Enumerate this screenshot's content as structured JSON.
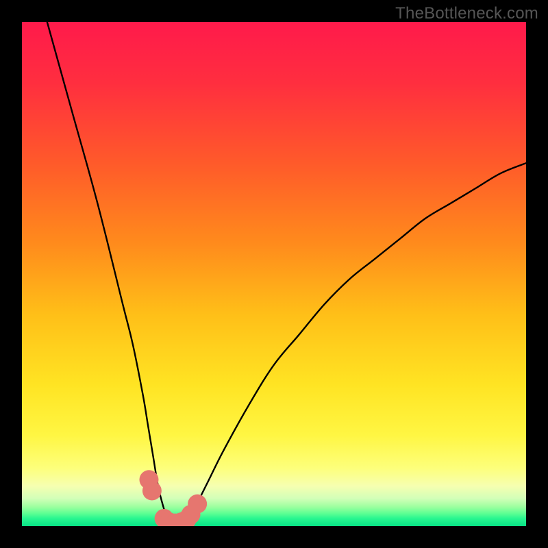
{
  "watermark": "TheBottleneck.com",
  "chart_data": {
    "type": "line",
    "title": "",
    "xlabel": "",
    "ylabel": "",
    "xlim": [
      0,
      100
    ],
    "ylim": [
      0,
      100
    ],
    "series": [
      {
        "name": "bottleneck-curve",
        "x": [
          5,
          10,
          15,
          20,
          22,
          24,
          25,
          26,
          27,
          28,
          29,
          30,
          31,
          32,
          33,
          34,
          35,
          37,
          40,
          45,
          50,
          55,
          60,
          65,
          70,
          75,
          80,
          85,
          90,
          95,
          100
        ],
        "y": [
          100,
          82,
          64,
          44,
          36,
          26,
          20,
          14,
          8,
          4,
          1,
          0,
          0,
          1,
          2,
          3,
          5,
          9,
          15,
          24,
          32,
          38,
          44,
          49,
          53,
          57,
          61,
          64,
          67,
          70,
          72
        ]
      }
    ],
    "markers": {
      "name": "highlight-points",
      "x": [
        25.2,
        25.8,
        28.2,
        29.2,
        30.4,
        31.6,
        32.7,
        33.5,
        34.8
      ],
      "y": [
        9.2,
        7.0,
        1.5,
        0.8,
        0.6,
        0.8,
        1.3,
        2.3,
        4.4
      ],
      "radius": 1.9
    },
    "gradient_stops": [
      {
        "offset": 0.0,
        "color": "#ff1a4b"
      },
      {
        "offset": 0.12,
        "color": "#ff2e3f"
      },
      {
        "offset": 0.28,
        "color": "#ff5a2a"
      },
      {
        "offset": 0.44,
        "color": "#ff8b1c"
      },
      {
        "offset": 0.58,
        "color": "#ffbf18"
      },
      {
        "offset": 0.72,
        "color": "#ffe423"
      },
      {
        "offset": 0.82,
        "color": "#fff643"
      },
      {
        "offset": 0.885,
        "color": "#fdff7b"
      },
      {
        "offset": 0.92,
        "color": "#f6ffb0"
      },
      {
        "offset": 0.945,
        "color": "#d3ffb8"
      },
      {
        "offset": 0.962,
        "color": "#9cff9f"
      },
      {
        "offset": 0.975,
        "color": "#5cff93"
      },
      {
        "offset": 0.985,
        "color": "#28f690"
      },
      {
        "offset": 1.0,
        "color": "#08e286"
      }
    ],
    "marker_color": "#e6766f",
    "curve_color": "#000000"
  }
}
